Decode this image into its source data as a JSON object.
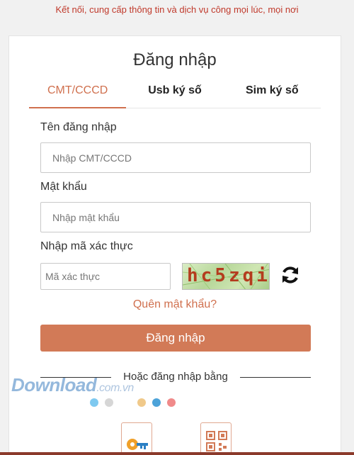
{
  "header": {
    "tagline": "Kết nối, cung cấp thông tin và dịch vụ công mọi lúc, mọi nơi"
  },
  "login": {
    "title": "Đăng nhập",
    "tabs": [
      {
        "label": "CMT/CCCD",
        "active": true
      },
      {
        "label": "Usb ký số",
        "active": false
      },
      {
        "label": "Sim ký số",
        "active": false
      }
    ],
    "username_label": "Tên đăng nhập",
    "username_placeholder": "Nhập CMT/CCCD",
    "username_value": "",
    "password_label": "Mật khẩu",
    "password_placeholder": "Nhập mật khẩu",
    "password_value": "",
    "captcha_label": "Nhập mã xác thực",
    "captcha_placeholder": "Mã xác thực",
    "captcha_value": "",
    "captcha_image_text": "hc5zqi",
    "refresh_icon": "refresh-icon",
    "forgot_link": "Quên mật khẩu?",
    "submit_label": "Đăng nhập",
    "alt_login_label": "Hoặc đăng nhập bằng",
    "alt_methods": [
      {
        "icon": "key-icon"
      },
      {
        "icon": "qr-code-icon"
      }
    ]
  },
  "watermark": {
    "brand": "Download",
    "domain": ".com.vn"
  },
  "colors": {
    "accent": "#d27a57",
    "tagline": "#c0392b",
    "active_tab": "#d0704e",
    "carousel_dots": [
      "#7ec9f0",
      "#d6d6d6",
      "#f0c98a",
      "#4da3d9",
      "#f08a8a"
    ]
  }
}
